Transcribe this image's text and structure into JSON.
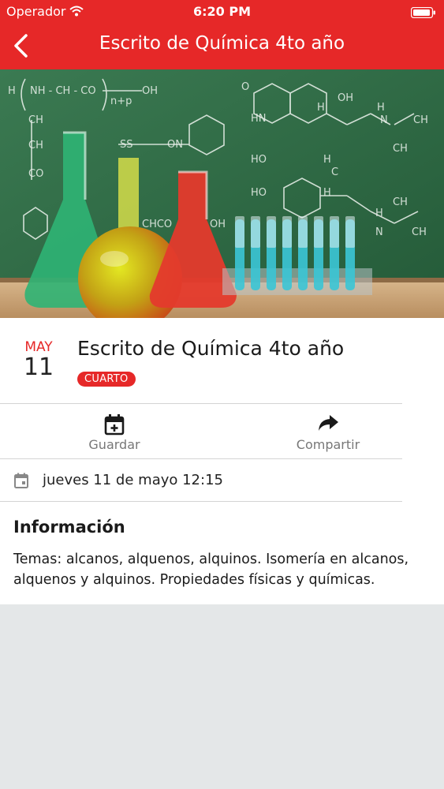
{
  "status_bar": {
    "carrier": "Operador",
    "time": "6:20 PM"
  },
  "nav": {
    "title": "Escrito de Química 4to año",
    "back_icon": "chevron-left-icon"
  },
  "hero": {
    "description_icon": "chemistry-lab-image"
  },
  "event": {
    "month": "MAY",
    "day": "11",
    "title": "Escrito de Química 4to año",
    "tag": "CUARTO"
  },
  "actions": {
    "save_label": "Guardar",
    "share_label": "Compartir"
  },
  "when": {
    "text": "jueves 11 de mayo 12:15"
  },
  "info": {
    "heading": "Información",
    "body": "Temas: alcanos, alquenos, alquinos. Isomería en alcanos, alquenos y alquinos. Propiedades físicas y químicas."
  },
  "colors": {
    "accent": "#e62828",
    "background": "#e4e7e8",
    "chalkboard": "#2e6b45"
  }
}
